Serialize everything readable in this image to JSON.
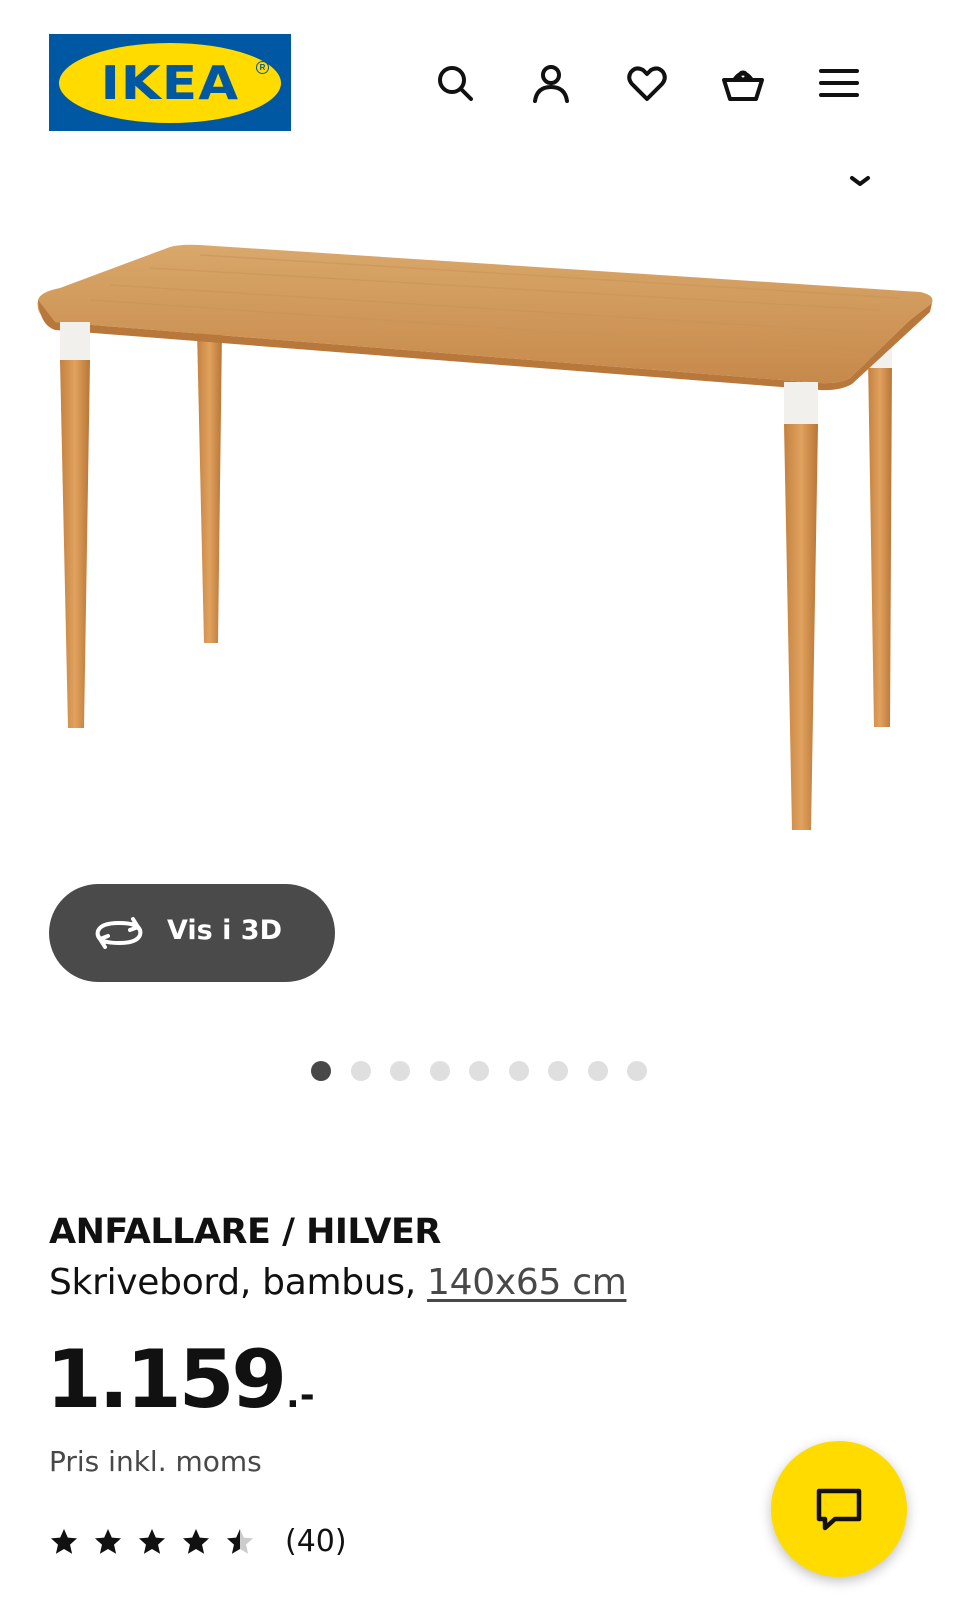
{
  "header": {
    "logo_text": "IKEA",
    "icons": [
      "search-icon",
      "account-icon",
      "heart-icon",
      "basket-icon",
      "menu-icon"
    ]
  },
  "gallery": {
    "view_3d_label": "Vis i 3D",
    "image_count": 9,
    "active_index": 0
  },
  "product": {
    "name": "ANFALLARE / HILVER",
    "description": "Skrivebord, bambus, ",
    "size": "140x65 cm",
    "price": "1.159",
    "price_suffix": ".-",
    "price_note": "Pris inkl. moms",
    "rating_value": 4.5,
    "rating_max": 5,
    "rating_count": "(40)"
  },
  "colors": {
    "ikea_blue": "#0058a3",
    "ikea_yellow": "#ffdb00",
    "button_dark": "#4a4a4a",
    "dot_active": "#484848",
    "dot_inactive": "#dfdfdf"
  }
}
